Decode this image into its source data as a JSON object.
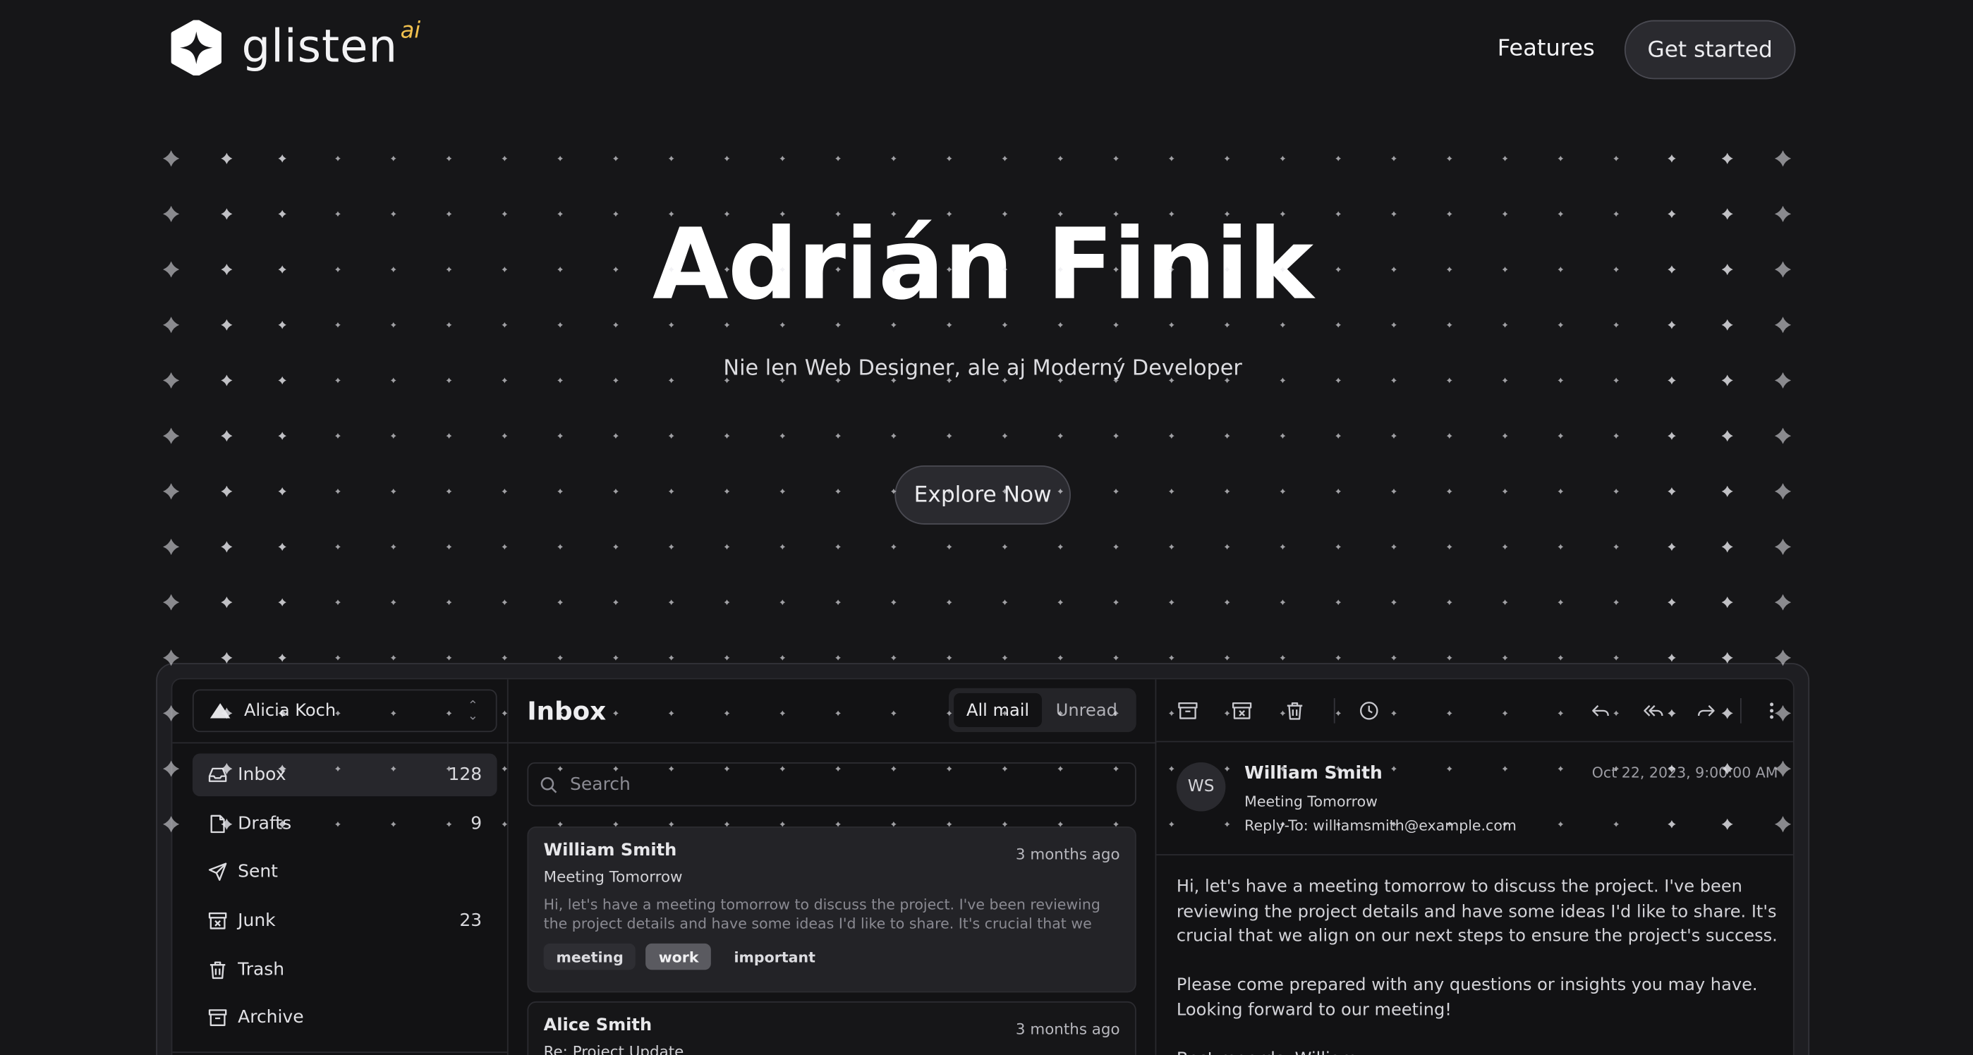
{
  "brand": {
    "name": "glisten",
    "suffix": "ai"
  },
  "nav": {
    "features": "Features",
    "cta": "Get started"
  },
  "hero": {
    "title": "Adrián Finik",
    "subtitle": "Nie len Web Designer, ale aj Moderný Developer",
    "button": "Explore Now"
  },
  "colors": {
    "background": "#161618",
    "accent_ai": "#f2c14e",
    "panel": "#121214",
    "selected_tag": "#5a5a60"
  },
  "app": {
    "account": {
      "name": "Alicia Koch",
      "icon": "triangle-logo-icon"
    },
    "folders": [
      {
        "label": "Inbox",
        "count": "128",
        "icon": "inbox-icon"
      },
      {
        "label": "Drafts",
        "count": "9",
        "icon": "file-icon"
      },
      {
        "label": "Sent",
        "count": "",
        "icon": "send-icon"
      },
      {
        "label": "Junk",
        "count": "23",
        "icon": "archive-x-icon"
      },
      {
        "label": "Trash",
        "count": "",
        "icon": "trash-icon"
      },
      {
        "label": "Archive",
        "count": "",
        "icon": "archive-icon"
      }
    ],
    "list": {
      "title": "Inbox",
      "filters": [
        "All mail",
        "Unread"
      ],
      "search_placeholder": "Search",
      "messages": [
        {
          "from": "William Smith",
          "when": "3 months ago",
          "subject": "Meeting Tomorrow",
          "preview": "Hi, let's have a meeting tomorrow to discuss the project. I've been reviewing the project details and have some ideas I'd like to share. It's crucial that we align on our…",
          "tags": [
            "meeting",
            "work",
            "important"
          ]
        },
        {
          "from": "Alice Smith",
          "when": "3 months ago",
          "subject": "Re: Project Update"
        }
      ]
    },
    "reader": {
      "toolbar_icons": [
        "archive-icon",
        "archive-x-icon",
        "trash-icon",
        "clock-icon",
        "reply-icon",
        "reply-all-icon",
        "forward-icon",
        "more-vertical-icon"
      ],
      "initials": "WS",
      "from": "William Smith",
      "subject": "Meeting Tomorrow",
      "reply_to": "Reply-To: williamsmith@example.com",
      "date": "Oct 22, 2023, 9:00:00 AM",
      "body": [
        "Hi, let's have a meeting tomorrow to discuss the project. I've been reviewing the project details and have some ideas I'd like to share. It's crucial that we align on our next steps to ensure the project's success.",
        "Please come prepared with any questions or insights you may have. Looking forward to our meeting!",
        "Best regards, William"
      ]
    }
  }
}
